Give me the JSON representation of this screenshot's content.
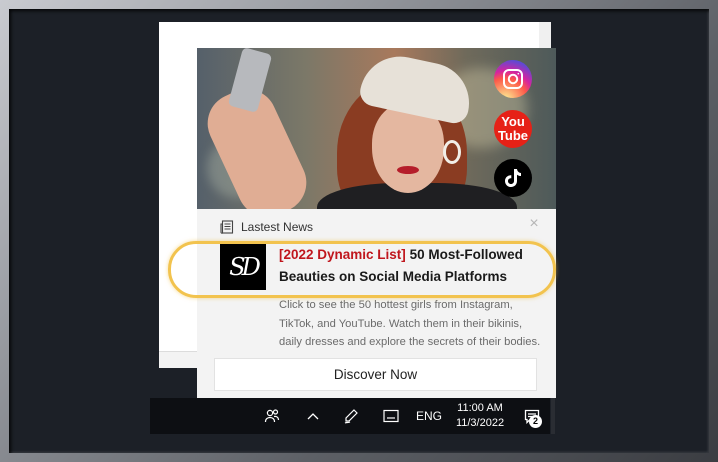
{
  "popup": {
    "section_label": "Lastest News",
    "close_label": "×",
    "logo_text": "SD",
    "headline_tag": "[2022 Dynamic List]",
    "headline_rest": " 50 Most-Followed Beauties on Social Media Platforms",
    "description": "Click to see the 50 hottest girls from Instagram, TikTok, and YouTube. Watch them in their bikinis, daily dresses and explore the secrets of their bodies.",
    "button_label": "Discover Now",
    "social_icons": [
      {
        "name": "instagram-icon"
      },
      {
        "name": "youtube-icon",
        "text_top": "You",
        "text_bottom": "Tube"
      },
      {
        "name": "tiktok-icon"
      }
    ]
  },
  "taskbar": {
    "language": "ENG",
    "time": "11:00 AM",
    "date": "11/3/2022",
    "notification_count": "2"
  },
  "colors": {
    "highlight": "#f2c34e",
    "headline_accent": "#c0161d",
    "taskbar_bg": "#0d0f13"
  }
}
